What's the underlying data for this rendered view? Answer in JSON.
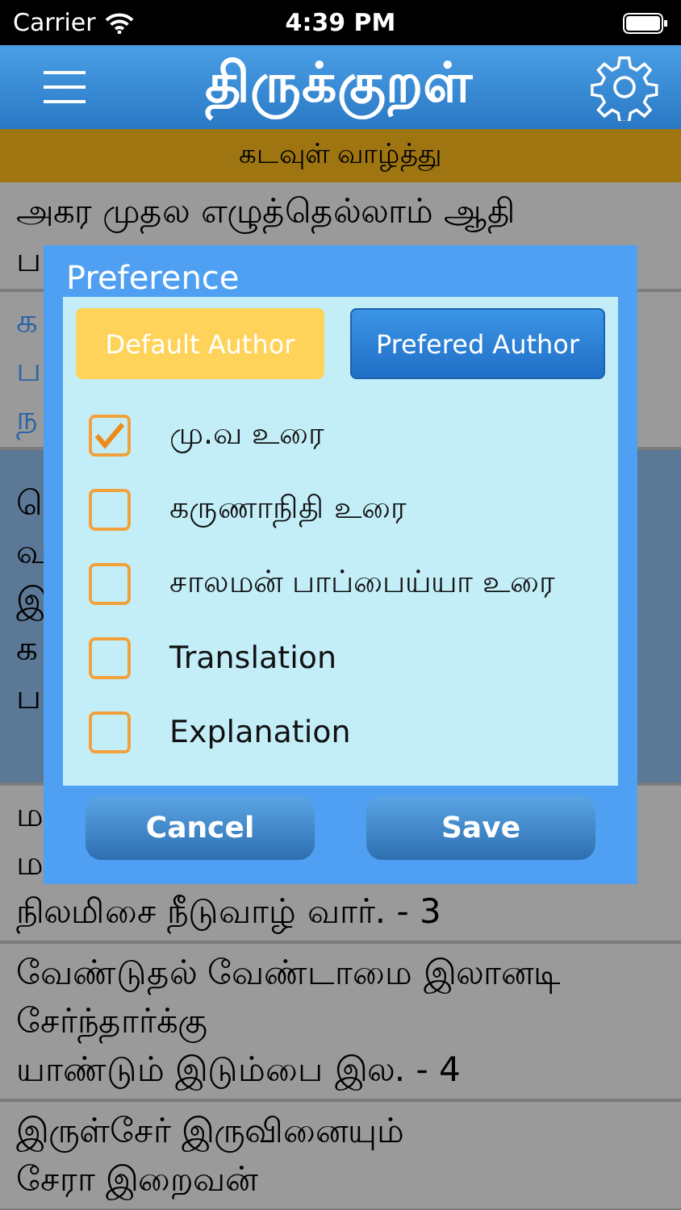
{
  "status_bar": {
    "carrier": "Carrier",
    "time": "4:39 PM"
  },
  "header": {
    "title": "திருக்குறள்"
  },
  "section": {
    "title": "கடவுள் வாழ்த்து"
  },
  "rows": [
    {
      "lines": [
        "அகர முதல எழுத்தெல்லாம் ஆதி",
        "ப"
      ],
      "selected": false,
      "emphasized": false
    },
    {
      "lines": [
        "க",
        "ப",
        "ந"
      ],
      "selected": false,
      "emphasized": true
    },
    {
      "lines": [
        "ெ",
        "வ",
        "இ",
        "க",
        "ப"
      ],
      "selected": true,
      "emphasized": false
    },
    {
      "lines": [
        "ம",
        "ம",
        "நிலமிசை நீடுவாழ் வார்.  - 3"
      ],
      "selected": false,
      "emphasized": false
    },
    {
      "lines": [
        "வேண்டுதல் வேண்டாமை இலானடி",
        "சேர்ந்தார்க்கு",
        "யாண்டும் இடும்பை இல. - 4"
      ],
      "selected": false,
      "emphasized": false
    },
    {
      "lines": [
        "இருள்சேர் இருவினையும்",
        "சேரா இறைவன்"
      ],
      "selected": false,
      "emphasized": false
    }
  ],
  "dialog": {
    "title": "Preference",
    "tabs": [
      {
        "label": "Default Author",
        "selected": true
      },
      {
        "label": "Prefered Author",
        "selected": false
      }
    ],
    "options": [
      {
        "label": "மு.வ உரை",
        "checked": true
      },
      {
        "label": "கருணாநிதி உரை",
        "checked": false
      },
      {
        "label": "சாலமன் பாப்பைய்யா உரை",
        "checked": false
      },
      {
        "label": "Translation",
        "checked": false
      },
      {
        "label": "Explanation",
        "checked": false
      }
    ],
    "buttons": [
      "Cancel",
      "Save"
    ]
  }
}
